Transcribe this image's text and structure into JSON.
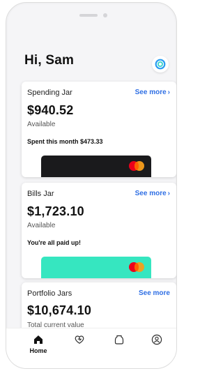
{
  "header": {
    "greeting": "Hi, Sam",
    "status_icon": "rings-icon"
  },
  "cards": {
    "spending": {
      "title": "Spending Jar",
      "see_more": "See more",
      "amount": "$940.52",
      "amount_label": "Available",
      "note": "Spent this month $473.33",
      "card_color": "#1a1a1c"
    },
    "bills": {
      "title": "Bills Jar",
      "see_more": "See more",
      "amount": "$1,723.10",
      "amount_label": "Available",
      "note": "You're all paid up!",
      "card_color": "#36e6c0"
    },
    "portfolio": {
      "title": "Portfolio Jars",
      "see_more": "See more",
      "amount": "$10,674.10",
      "amount_label": "Total current value"
    }
  },
  "tabbar": {
    "items": [
      {
        "label": "Home",
        "icon": "home-icon",
        "active": true
      },
      {
        "label": "",
        "icon": "heart-icon",
        "active": false
      },
      {
        "label": "",
        "icon": "jar-icon",
        "active": false
      },
      {
        "label": "",
        "icon": "profile-icon",
        "active": false
      }
    ]
  },
  "colors": {
    "accent_blue": "#2f6fe4",
    "mint": "#36e6c0",
    "dark_card": "#1a1a1c",
    "mastercard_red": "#eb001b",
    "mastercard_orange": "#f79e1b"
  }
}
